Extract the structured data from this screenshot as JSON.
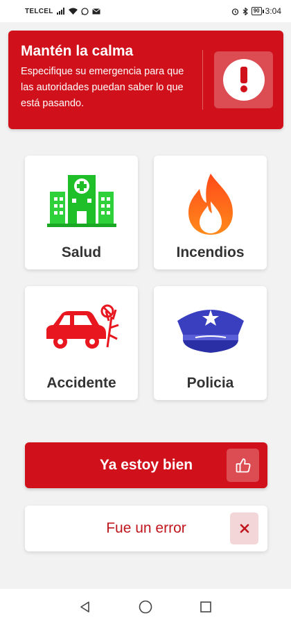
{
  "status_bar": {
    "carrier": "TELCEL",
    "battery": "90",
    "time": "3:04"
  },
  "header": {
    "title": "Mantén la calma",
    "subtitle": "Especifique su emergencia para que las autoridades puedan saber lo que está pasando.",
    "icon": "exclamation-icon"
  },
  "categories": [
    {
      "label": "Salud",
      "icon": "hospital-icon"
    },
    {
      "label": "Incendios",
      "icon": "fire-icon"
    },
    {
      "label": "Accidente",
      "icon": "car-crash-icon"
    },
    {
      "label": "Policia",
      "icon": "police-cap-icon"
    }
  ],
  "actions": {
    "ok_label": "Ya estoy bien",
    "ok_icon": "thumbs-up-icon",
    "error_label": "Fue un error",
    "error_icon": "close-icon"
  },
  "nav": {
    "back_icon": "back-triangle-icon",
    "home_icon": "home-circle-icon",
    "recents_icon": "recents-square-icon"
  },
  "colors": {
    "primary": "#d0101a",
    "background": "#f2f2f2",
    "card": "#ffffff"
  }
}
